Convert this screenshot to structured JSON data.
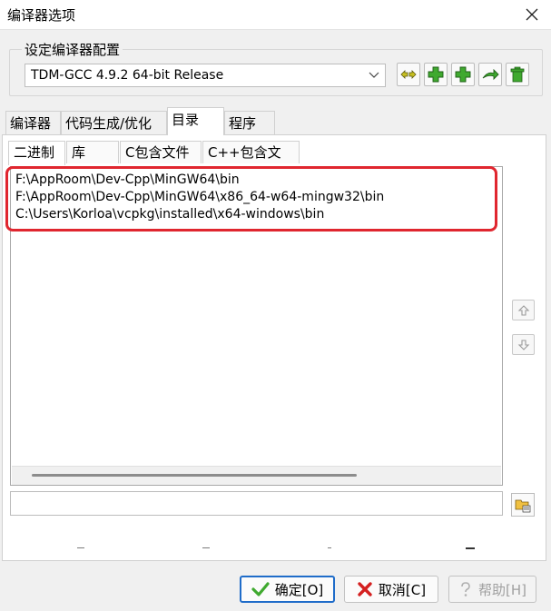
{
  "window": {
    "title": "编译器选项"
  },
  "compiler_set": {
    "group_label": "设定编译器配置",
    "selected": "TDM-GCC 4.9.2 64-bit Release"
  },
  "main_tabs": [
    {
      "label": "编译器"
    },
    {
      "label": "代码生成/优化"
    },
    {
      "label": "目录",
      "active": true
    },
    {
      "label": "程序"
    }
  ],
  "sub_tabs": [
    {
      "label": "二进制",
      "active": true
    },
    {
      "label": "库"
    },
    {
      "label": "C包含文件"
    },
    {
      "label": "C++包含文件"
    }
  ],
  "directories": [
    "F:\\AppRoom\\Dev-Cpp\\MinGW64\\bin",
    "F:\\AppRoom\\Dev-Cpp\\MinGW64\\x86_64-w64-mingw32\\bin",
    "C:\\Users\\Korloa\\vcpkg\\installed\\x64-windows\\bin"
  ],
  "path_input": {
    "value": ""
  },
  "buttons": {
    "ok": "确定[O]",
    "cancel": "取消[C]",
    "help": "帮助[H]"
  },
  "colors": {
    "highlight": "#e0262f",
    "accent": "#1f6cc9",
    "green_icon": "#3fa92f"
  },
  "icons": [
    "close-icon",
    "chevron-down-icon",
    "rename-icon",
    "add-icon",
    "copy-add-icon",
    "arrow-icon",
    "trash-icon",
    "move-up-icon",
    "move-down-icon",
    "browse-folder-icon",
    "check-icon",
    "x-icon",
    "help-icon"
  ]
}
